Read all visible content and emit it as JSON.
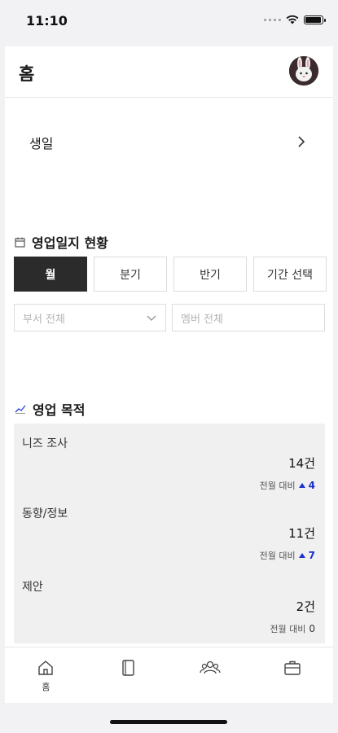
{
  "status_bar": {
    "time": "11:10"
  },
  "header": {
    "title": "홈"
  },
  "birthday": {
    "label": "생일"
  },
  "sales_log": {
    "title": "영업일지 현황",
    "periods": [
      "월",
      "분기",
      "반기",
      "기간 선택"
    ],
    "active_period": "월",
    "department_placeholder": "부서 전체",
    "member_placeholder": "멤버 전체"
  },
  "sales_goal": {
    "title": "영업 목적",
    "items": [
      {
        "label": "니즈 조사",
        "value": "14건",
        "compare_label": "전월 대비",
        "delta": "4",
        "trend": "up"
      },
      {
        "label": "동향/정보",
        "value": "11건",
        "compare_label": "전월 대비",
        "delta": "7",
        "trend": "up"
      },
      {
        "label": "제안",
        "value": "2건",
        "compare_label": "전월 대비",
        "delta": "0",
        "trend": "none"
      }
    ]
  },
  "tabbar": {
    "home_label": "홈"
  },
  "colors": {
    "accent_up": "#1a2fd0",
    "active_button": "#2b2b2b"
  }
}
